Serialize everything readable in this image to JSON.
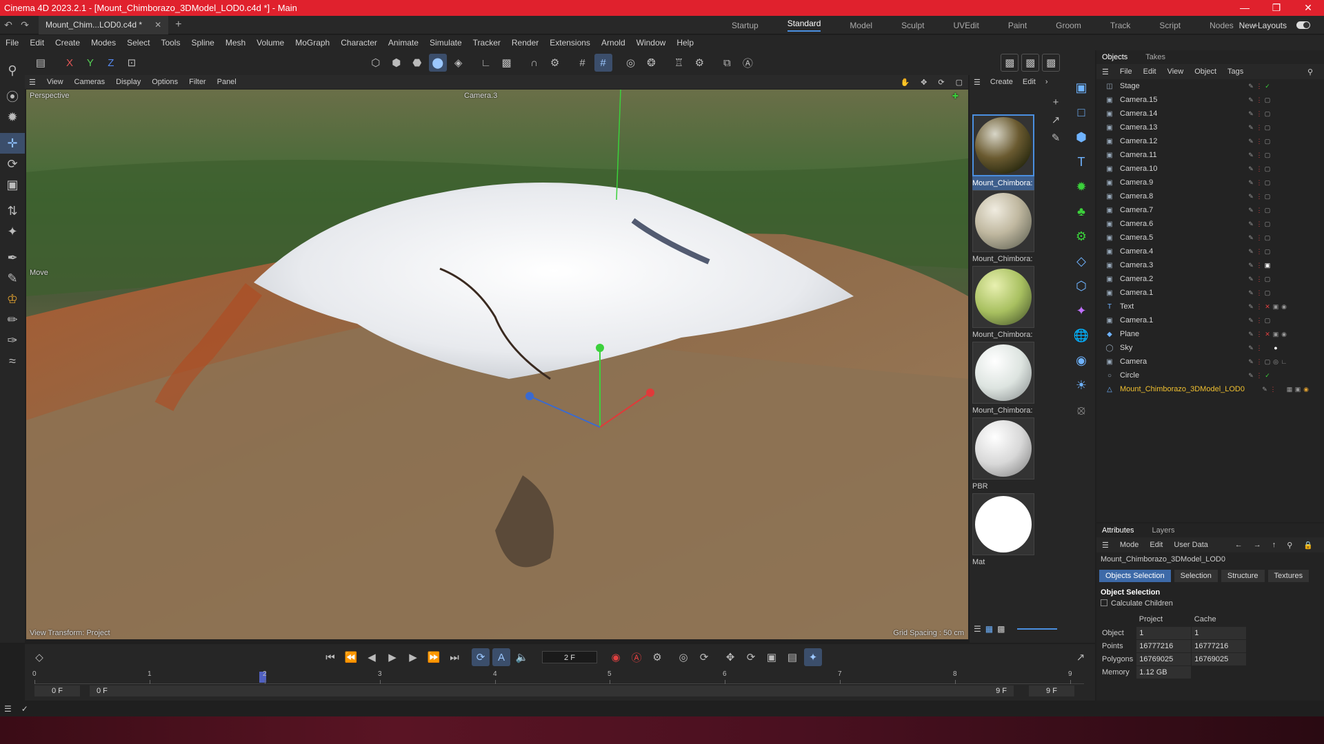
{
  "titlebar": {
    "title": "Cinema 4D 2023.2.1 - [Mount_Chimborazo_3DModel_LOD0.c4d *] - Main"
  },
  "tabs": {
    "doc_tab": "Mount_Chim...LOD0.c4d *",
    "layouts": [
      "Startup",
      "Standard",
      "Model",
      "Sculpt",
      "UVEdit",
      "Paint",
      "Groom",
      "Track",
      "Script",
      "Nodes"
    ],
    "new_layouts": "New Layouts"
  },
  "menu": [
    "File",
    "Edit",
    "Create",
    "Modes",
    "Select",
    "Tools",
    "Spline",
    "Mesh",
    "Volume",
    "MoGraph",
    "Character",
    "Animate",
    "Simulate",
    "Tracker",
    "Render",
    "Extensions",
    "Arnold",
    "Window",
    "Help"
  ],
  "axis_buttons": {
    "x": "X",
    "y": "Y",
    "z": "Z"
  },
  "viewport_menu": [
    "View",
    "Cameras",
    "Display",
    "Options",
    "Filter",
    "Panel"
  ],
  "viewport": {
    "projection": "Perspective",
    "camera": "Camera.3",
    "tool": "Move",
    "view_transform": "View Transform: Project",
    "grid_spacing": "Grid Spacing : 50 cm"
  },
  "material_menu": [
    "Create",
    "Edit"
  ],
  "materials": [
    {
      "name": "Mount_Chimbora:",
      "selected": true
    },
    {
      "name": "Mount_Chimbora:",
      "selected": false
    },
    {
      "name": "Mount_Chimbora:",
      "selected": false
    },
    {
      "name": "Mount_Chimbora:",
      "selected": false
    },
    {
      "name": "PBR",
      "selected": false
    },
    {
      "name": "Mat",
      "selected": false
    }
  ],
  "objects_panel": {
    "tabs": [
      "Objects",
      "Takes"
    ],
    "menu": [
      "File",
      "Edit",
      "View",
      "Object",
      "Tags"
    ],
    "items": [
      {
        "name": "Stage",
        "icon": "stage-icon"
      },
      {
        "name": "Camera.15",
        "icon": "camera-icon"
      },
      {
        "name": "Camera.14",
        "icon": "camera-icon"
      },
      {
        "name": "Camera.13",
        "icon": "camera-icon"
      },
      {
        "name": "Camera.12",
        "icon": "camera-icon"
      },
      {
        "name": "Camera.11",
        "icon": "camera-icon"
      },
      {
        "name": "Camera.10",
        "icon": "camera-icon"
      },
      {
        "name": "Camera.9",
        "icon": "camera-icon"
      },
      {
        "name": "Camera.8",
        "icon": "camera-icon"
      },
      {
        "name": "Camera.7",
        "icon": "camera-icon"
      },
      {
        "name": "Camera.6",
        "icon": "camera-icon"
      },
      {
        "name": "Camera.5",
        "icon": "camera-icon"
      },
      {
        "name": "Camera.4",
        "icon": "camera-icon"
      },
      {
        "name": "Camera.3",
        "icon": "camera-icon"
      },
      {
        "name": "Camera.2",
        "icon": "camera-icon"
      },
      {
        "name": "Camera.1",
        "icon": "camera-icon"
      },
      {
        "name": "Text",
        "icon": "text-icon"
      },
      {
        "name": "Camera.1",
        "icon": "camera-icon"
      },
      {
        "name": "Plane",
        "icon": "plane-icon"
      },
      {
        "name": "Sky",
        "icon": "sky-icon"
      },
      {
        "name": "Camera",
        "icon": "camera-icon"
      },
      {
        "name": "Circle",
        "icon": "circle-icon"
      },
      {
        "name": "Mount_Chimborazo_3DModel_LOD0",
        "icon": "mesh-icon",
        "selected": true
      }
    ]
  },
  "attributes": {
    "tabs": [
      "Attributes",
      "Layers"
    ],
    "menu": [
      "Mode",
      "Edit",
      "User Data"
    ],
    "object_name": "Mount_Chimborazo_3DModel_LOD0",
    "buttons": [
      "Objects Selection",
      "Selection",
      "Structure",
      "Textures"
    ],
    "section_title": "Object Selection",
    "checkbox_label": "Calculate Children",
    "col_project": "Project",
    "col_cache": "Cache",
    "rows": [
      {
        "label": "Object",
        "project": "1",
        "cache": "1"
      },
      {
        "label": "Points",
        "project": "16777216",
        "cache": "16777216"
      },
      {
        "label": "Polygons",
        "project": "16769025",
        "cache": "16769025"
      },
      {
        "label": "Memory",
        "project": "1.12 GB",
        "cache": ""
      }
    ]
  },
  "timeline": {
    "current_frame": "2 F",
    "ticks": [
      "0",
      "1",
      "2",
      "3",
      "4",
      "5",
      "6",
      "7",
      "8",
      "9"
    ],
    "start": "0 F",
    "range_start": "0 F",
    "range_end": "9 F",
    "end": "9 F"
  },
  "colors": {
    "accent": "#4a8fe0",
    "titlebar": "#e0212d",
    "selected_object": "#f0c030"
  }
}
